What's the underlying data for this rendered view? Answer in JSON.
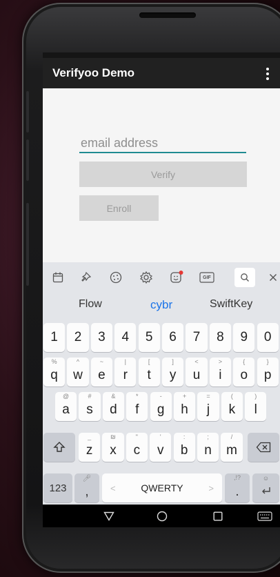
{
  "app": {
    "title": "Verifyoo Demo",
    "menu_icon": "more-vert-icon"
  },
  "form": {
    "email_placeholder": "email address",
    "email_value": "",
    "verify_label": "Verify",
    "enroll_label": "Enroll"
  },
  "keyboard": {
    "toolbar_icons": [
      "clipboard-icon",
      "pin-icon",
      "sticker-icon",
      "settings-icon",
      "emoji-icon",
      "gif-icon",
      "search-icon",
      "close-icon"
    ],
    "gif_label": "GIF",
    "suggestions": [
      "Flow",
      "cybr",
      "SwiftKey"
    ],
    "number_row": [
      "1",
      "2",
      "3",
      "4",
      "5",
      "6",
      "7",
      "8",
      "9",
      "0"
    ],
    "row1": [
      {
        "k": "q",
        "h": "%"
      },
      {
        "k": "w",
        "h": "^"
      },
      {
        "k": "e",
        "h": "~"
      },
      {
        "k": "r",
        "h": "|"
      },
      {
        "k": "t",
        "h": "["
      },
      {
        "k": "y",
        "h": "]"
      },
      {
        "k": "u",
        "h": "<"
      },
      {
        "k": "i",
        "h": ">"
      },
      {
        "k": "o",
        "h": "{"
      },
      {
        "k": "p",
        "h": "}"
      }
    ],
    "row2": [
      {
        "k": "a",
        "h": "@"
      },
      {
        "k": "s",
        "h": "#"
      },
      {
        "k": "d",
        "h": "&"
      },
      {
        "k": "f",
        "h": "*"
      },
      {
        "k": "g",
        "h": "-"
      },
      {
        "k": "h",
        "h": "+"
      },
      {
        "k": "j",
        "h": "="
      },
      {
        "k": "k",
        "h": "("
      },
      {
        "k": "l",
        "h": ")"
      }
    ],
    "row3": [
      {
        "k": "z",
        "h": "_"
      },
      {
        "k": "x",
        "h": "₪"
      },
      {
        "k": "c",
        "h": "\""
      },
      {
        "k": "v",
        "h": "'"
      },
      {
        "k": "b",
        "h": ":"
      },
      {
        "k": "n",
        "h": ";"
      },
      {
        "k": "m",
        "h": "/"
      }
    ],
    "symbols_label": "123",
    "comma_label": ",",
    "space_label": "QWERTY",
    "period_label": ".",
    "period_hint": ",!?"
  },
  "colors": {
    "accent": "#1f8a91",
    "appbar": "#212121",
    "suggestion_highlight": "#1a73e8"
  }
}
